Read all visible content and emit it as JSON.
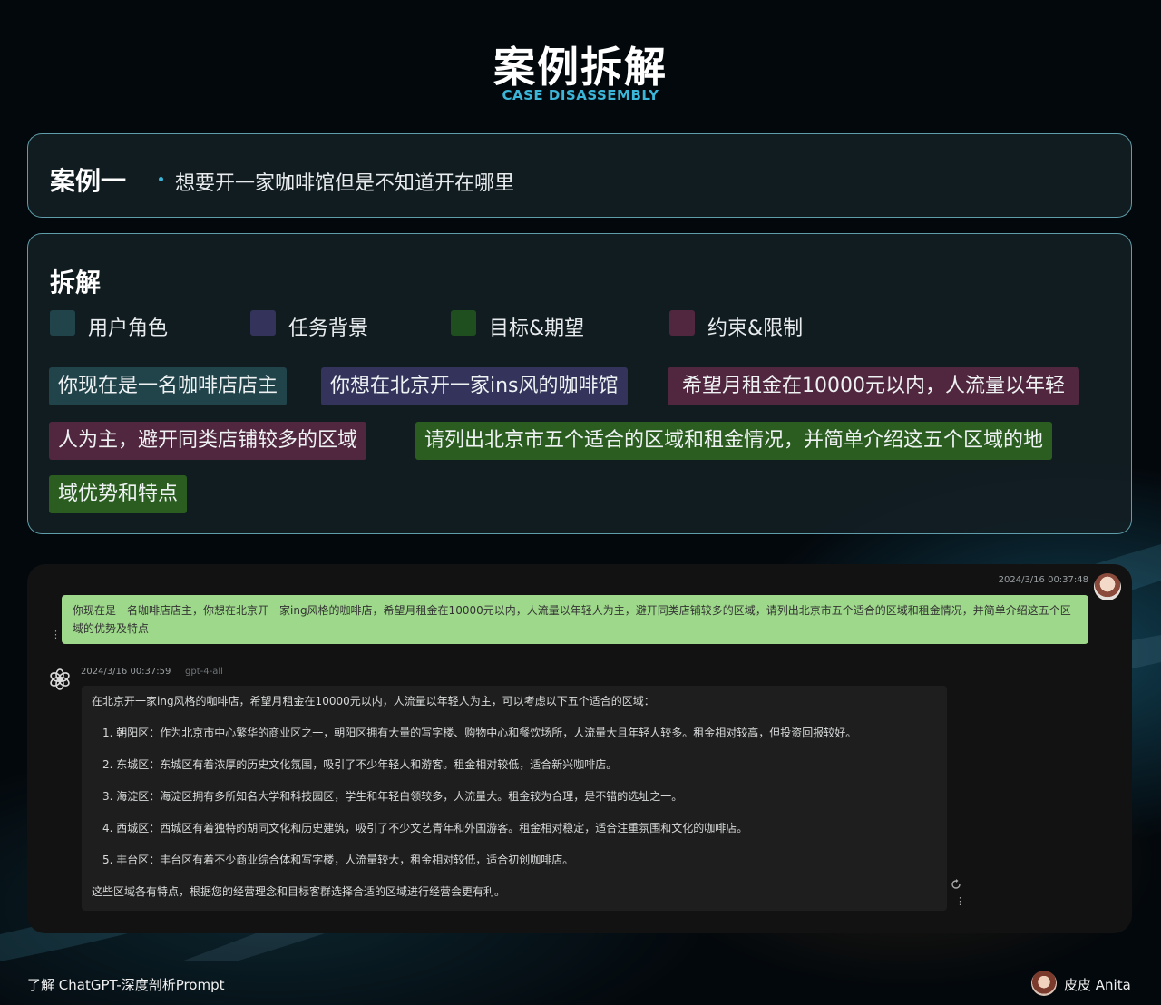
{
  "header": {
    "title": "案例拆解",
    "subtitle": "CASE DISASSEMBLY"
  },
  "case": {
    "title": "案例一",
    "description": "想要开一家咖啡馆但是不知道开在哪里"
  },
  "breakdown": {
    "title": "拆解",
    "legend": [
      {
        "label": "用户角色",
        "color": "#21434a"
      },
      {
        "label": "任务背景",
        "color": "#33335b"
      },
      {
        "label": "目标&期望",
        "color": "#1f4f1e"
      },
      {
        "label": "约束&限制",
        "color": "#51263f"
      }
    ],
    "chips": [
      {
        "text": "你现在是一名咖啡店店主",
        "color": "#21434a"
      },
      {
        "text": "你想在北京开一家ins风的咖啡馆",
        "color": "#33335b"
      },
      {
        "text": "希望月租金在10000元以内，人流量以年轻",
        "color": "#51263f"
      },
      {
        "text": "人为主，避开同类店铺较多的区域",
        "color": "#51263f"
      },
      {
        "text": "请列出北京市五个适合的区域和租金情况，并简单介绍这五个区域的地",
        "color": "#2a5d1f"
      },
      {
        "text": "域优势和特点",
        "color": "#2a5d1f"
      }
    ]
  },
  "chat": {
    "user": {
      "timestamp": "2024/3/16 00:37:48",
      "message": "你现在是一名咖啡店店主，你想在北京开一家ing风格的咖啡店，希望月租金在10000元以内，人流量以年轻人为主，避开同类店铺较多的区域，请列出北京市五个适合的区域和租金情况，并简单介绍这五个区域的优势及特点"
    },
    "assistant": {
      "timestamp": "2024/3/16 00:37:59",
      "model": "gpt-4-all",
      "intro": "在北京开一家ing风格的咖啡店，希望月租金在10000元以内，人流量以年轻人为主，可以考虑以下五个适合的区域：",
      "items": [
        "1. 朝阳区：作为北京市中心繁华的商业区之一，朝阳区拥有大量的写字楼、购物中心和餐饮场所，人流量大且年轻人较多。租金相对较高，但投资回报较好。",
        "2. 东城区：东城区有着浓厚的历史文化氛围，吸引了不少年轻人和游客。租金相对较低，适合新兴咖啡店。",
        "3. 海淀区：海淀区拥有多所知名大学和科技园区，学生和年轻白领较多，人流量大。租金较为合理，是不错的选址之一。",
        "4. 西城区：西城区有着独特的胡同文化和历史建筑，吸引了不少文艺青年和外国游客。租金相对稳定，适合注重氛围和文化的咖啡店。",
        "5. 丰台区：丰台区有着不少商业综合体和写字楼，人流量较大，租金相对较低，适合初创咖啡店。"
      ],
      "conclusion": "这些区域各有特点，根据您的经营理念和目标客群选择合适的区域进行经营会更有利。"
    }
  },
  "footer": {
    "left": "了解 ChatGPT-深度剖析Prompt",
    "author": "皮皮 Anita"
  }
}
